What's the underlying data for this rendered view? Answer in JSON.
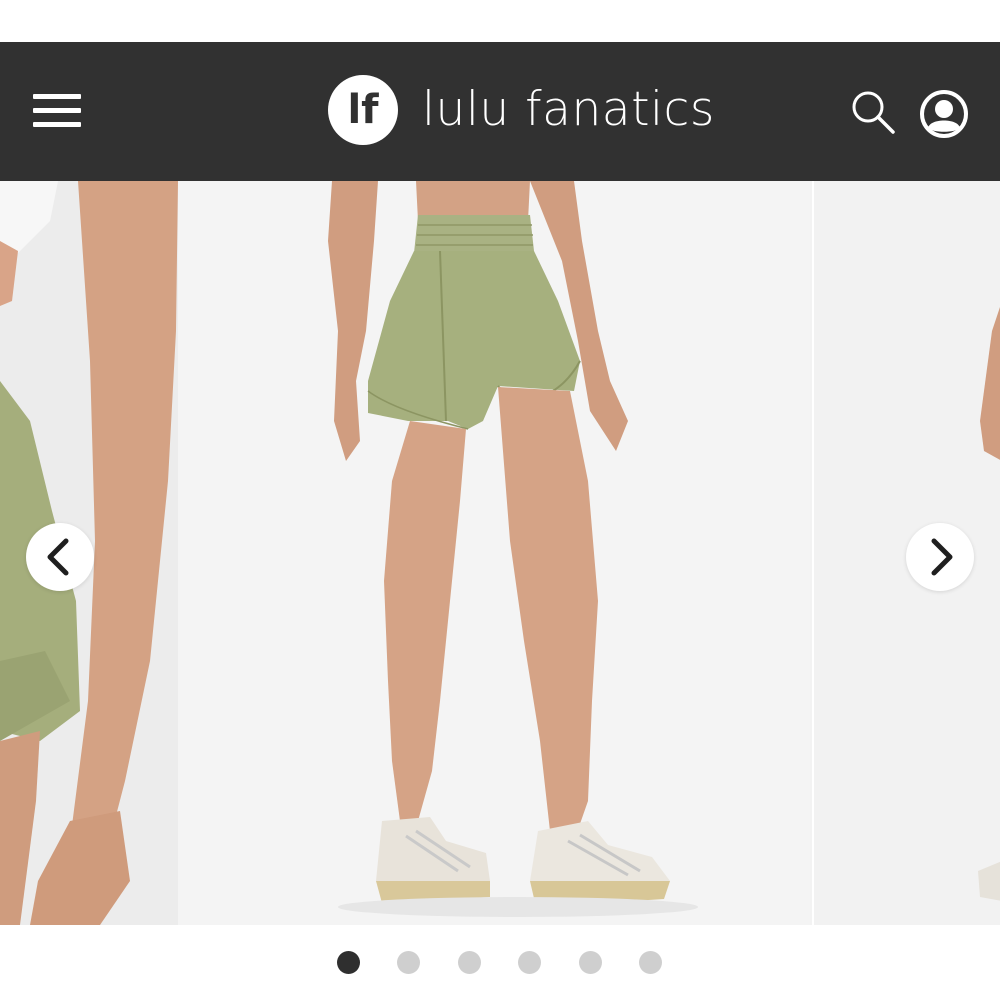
{
  "header": {
    "menu_icon": "hamburger-menu-icon",
    "logo_mark_text": "lf",
    "brand_name": "lulu fanatics",
    "search_icon": "search-icon",
    "account_icon": "account-icon",
    "background_color": "#313131"
  },
  "gallery": {
    "product_color": "#a6b07e",
    "prev_icon": "chevron-left-icon",
    "next_icon": "chevron-right-icon",
    "slide_count": 6,
    "active_slide": 1
  }
}
